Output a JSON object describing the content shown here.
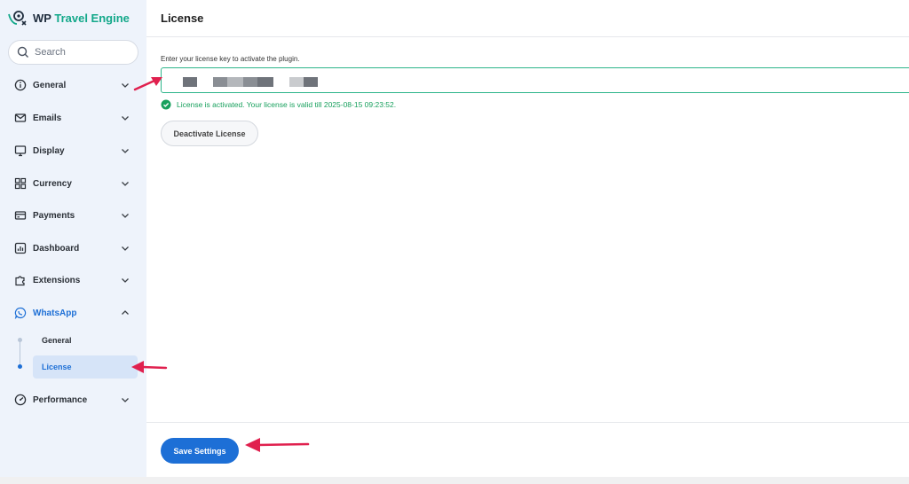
{
  "app": {
    "logo_wp": "WP",
    "logo_rest": "Travel Engine"
  },
  "search": {
    "placeholder": "Search"
  },
  "sidebar": {
    "items": [
      {
        "label": "General",
        "icon": "info-icon"
      },
      {
        "label": "Emails",
        "icon": "mail-icon"
      },
      {
        "label": "Display",
        "icon": "display-icon"
      },
      {
        "label": "Currency",
        "icon": "grid-icon"
      },
      {
        "label": "Payments",
        "icon": "card-icon"
      },
      {
        "label": "Dashboard",
        "icon": "chart-icon"
      },
      {
        "label": "Extensions",
        "icon": "puzzle-icon"
      },
      {
        "label": "WhatsApp",
        "icon": "whatsapp-icon",
        "expanded": true
      },
      {
        "label": "Performance",
        "icon": "gauge-icon"
      }
    ],
    "whatsapp_sub": [
      {
        "label": "General"
      },
      {
        "label": "License",
        "active": true
      }
    ]
  },
  "main": {
    "title": "License",
    "field_label": "Enter your license key to activate the plugin.",
    "license_value": "",
    "status_text": "License is activated. Your license is valid till 2025-08-15 09:23:52.",
    "deactivate_label": "Deactivate License"
  },
  "footer": {
    "save_label": "Save Settings"
  },
  "colors": {
    "accent": "#1d6fd6",
    "success": "#17a05d",
    "sidebar_bg": "#eef3fb",
    "annotation_arrow": "#e0204e"
  }
}
